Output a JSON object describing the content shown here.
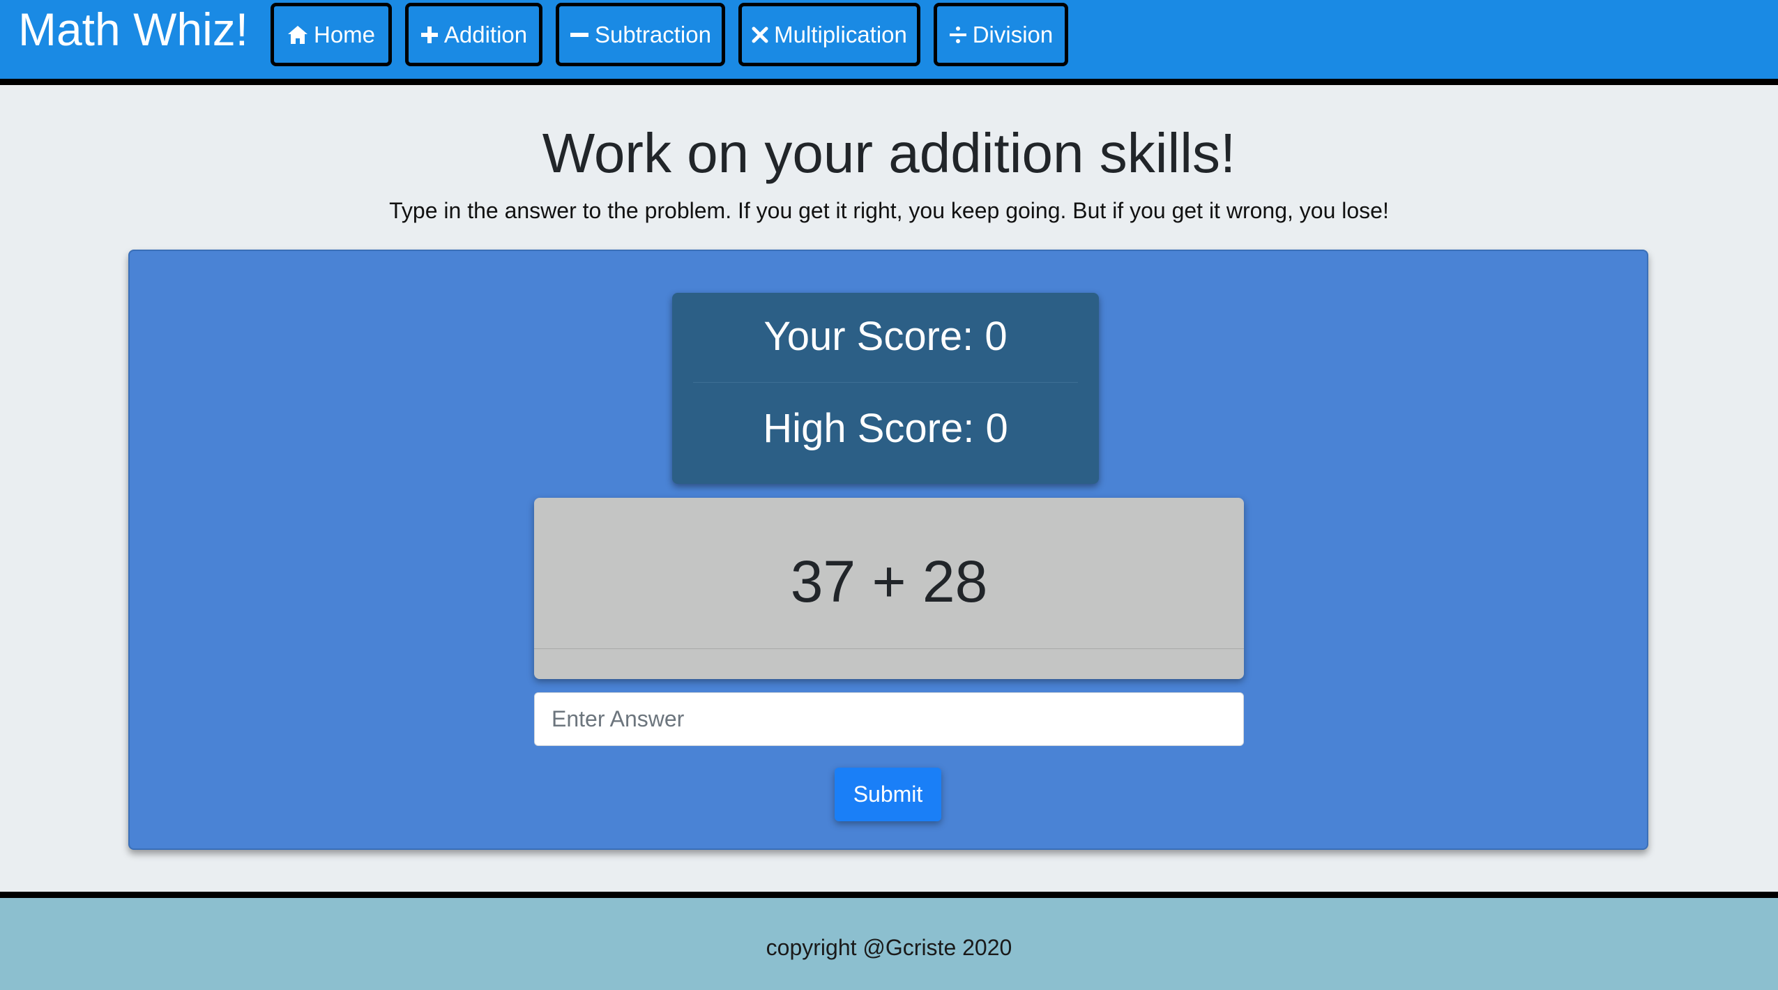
{
  "navbar": {
    "brand": "Math Whiz!",
    "items": [
      {
        "label": "Home",
        "icon": "home-icon"
      },
      {
        "label": "Addition",
        "icon": "plus-icon"
      },
      {
        "label": "Subtraction",
        "icon": "minus-icon"
      },
      {
        "label": "Multiplication",
        "icon": "times-icon"
      },
      {
        "label": "Division",
        "icon": "divide-icon"
      }
    ]
  },
  "main": {
    "heading": "Work on your addition skills!",
    "instructions": "Type in the answer to the problem. If you get it right, you keep going. But if you get it wrong, you lose!"
  },
  "scores": {
    "your_score": "Your Score: 0",
    "high_score": "High Score: 0"
  },
  "problem": {
    "text": "37 + 28"
  },
  "answer": {
    "placeholder": "Enter Answer",
    "value": ""
  },
  "submit": {
    "label": "Submit"
  },
  "footer": {
    "text": "copyright @Gcriste 2020"
  },
  "colors": {
    "navbar": "#1a8ae4",
    "panel": "#4a83d5",
    "score_card": "#2c5f86",
    "problem_card": "#c4c5c4",
    "submit": "#1a7ff7",
    "footer": "#8cbfcf"
  }
}
